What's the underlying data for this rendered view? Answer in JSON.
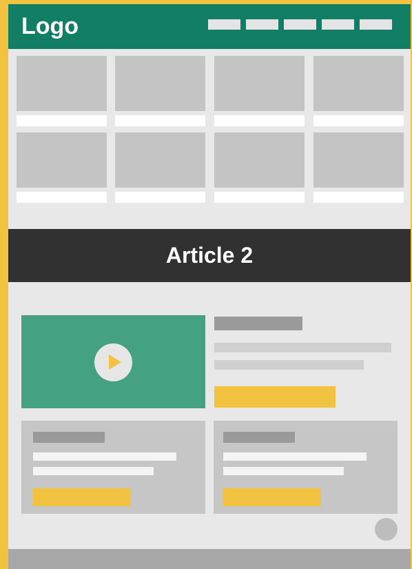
{
  "header": {
    "logo": "Logo",
    "nav_item_count": 5
  },
  "gallery": {
    "rows": 2,
    "columns": 4
  },
  "article": {
    "title": "Article 2"
  },
  "colors": {
    "background": "#f2c340",
    "header": "#137e66",
    "banner": "#313131",
    "video": "#44a283",
    "accent": "#f2c340",
    "placeholder": "#c4c4c4",
    "page": "#e8e8e8"
  },
  "icons": {
    "play": "play-icon"
  }
}
